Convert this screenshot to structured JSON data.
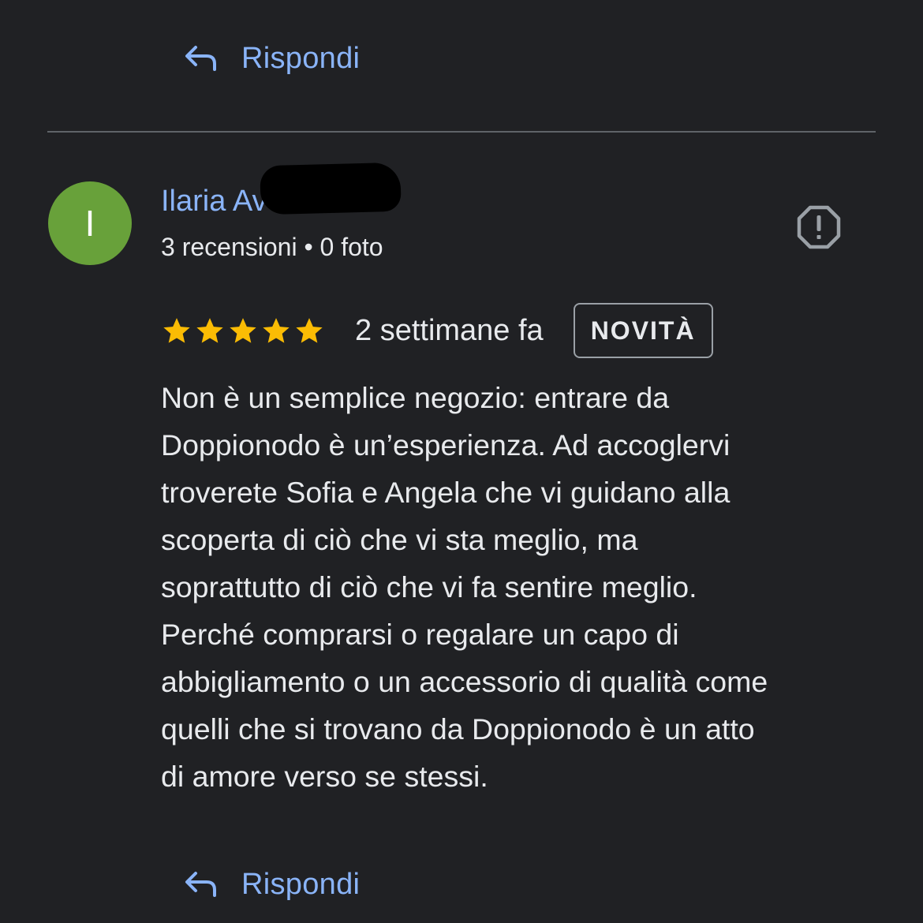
{
  "reply_top": {
    "icon": "reply-arrow-icon",
    "label": "Rispondi"
  },
  "review": {
    "author": {
      "initial": "I",
      "name": "Ilaria Av",
      "avatar_color": "#68a13a",
      "meta": "3 recensioni • 0 foto"
    },
    "report_icon": "report-octagon-icon",
    "rating": 5,
    "rating_max": 5,
    "star_color": "#fbbc04",
    "date": "2 settimane fa",
    "badge": "NOVITÀ",
    "text_lines": [
      "Non è un semplice negozio: entrare da",
      "Doppionodo è un’esperienza. Ad accoglervi",
      "troverete Sofia e Angela che vi guidano alla",
      "scoperta di ciò che vi sta meglio, ma",
      "soprattutto di ciò che vi fa sentire meglio.",
      "Perché comprarsi o regalare un capo di",
      "abbigliamento o un accessorio di qualità come",
      "quelli che si trovano da Doppionodo è un atto",
      "di amore verso se stessi."
    ]
  },
  "reply_bottom": {
    "icon": "reply-arrow-icon",
    "label": "Rispondi"
  },
  "colors": {
    "background": "#202124",
    "link": "#8ab4f8",
    "text": "#e8eaed",
    "divider": "#5f6368"
  }
}
